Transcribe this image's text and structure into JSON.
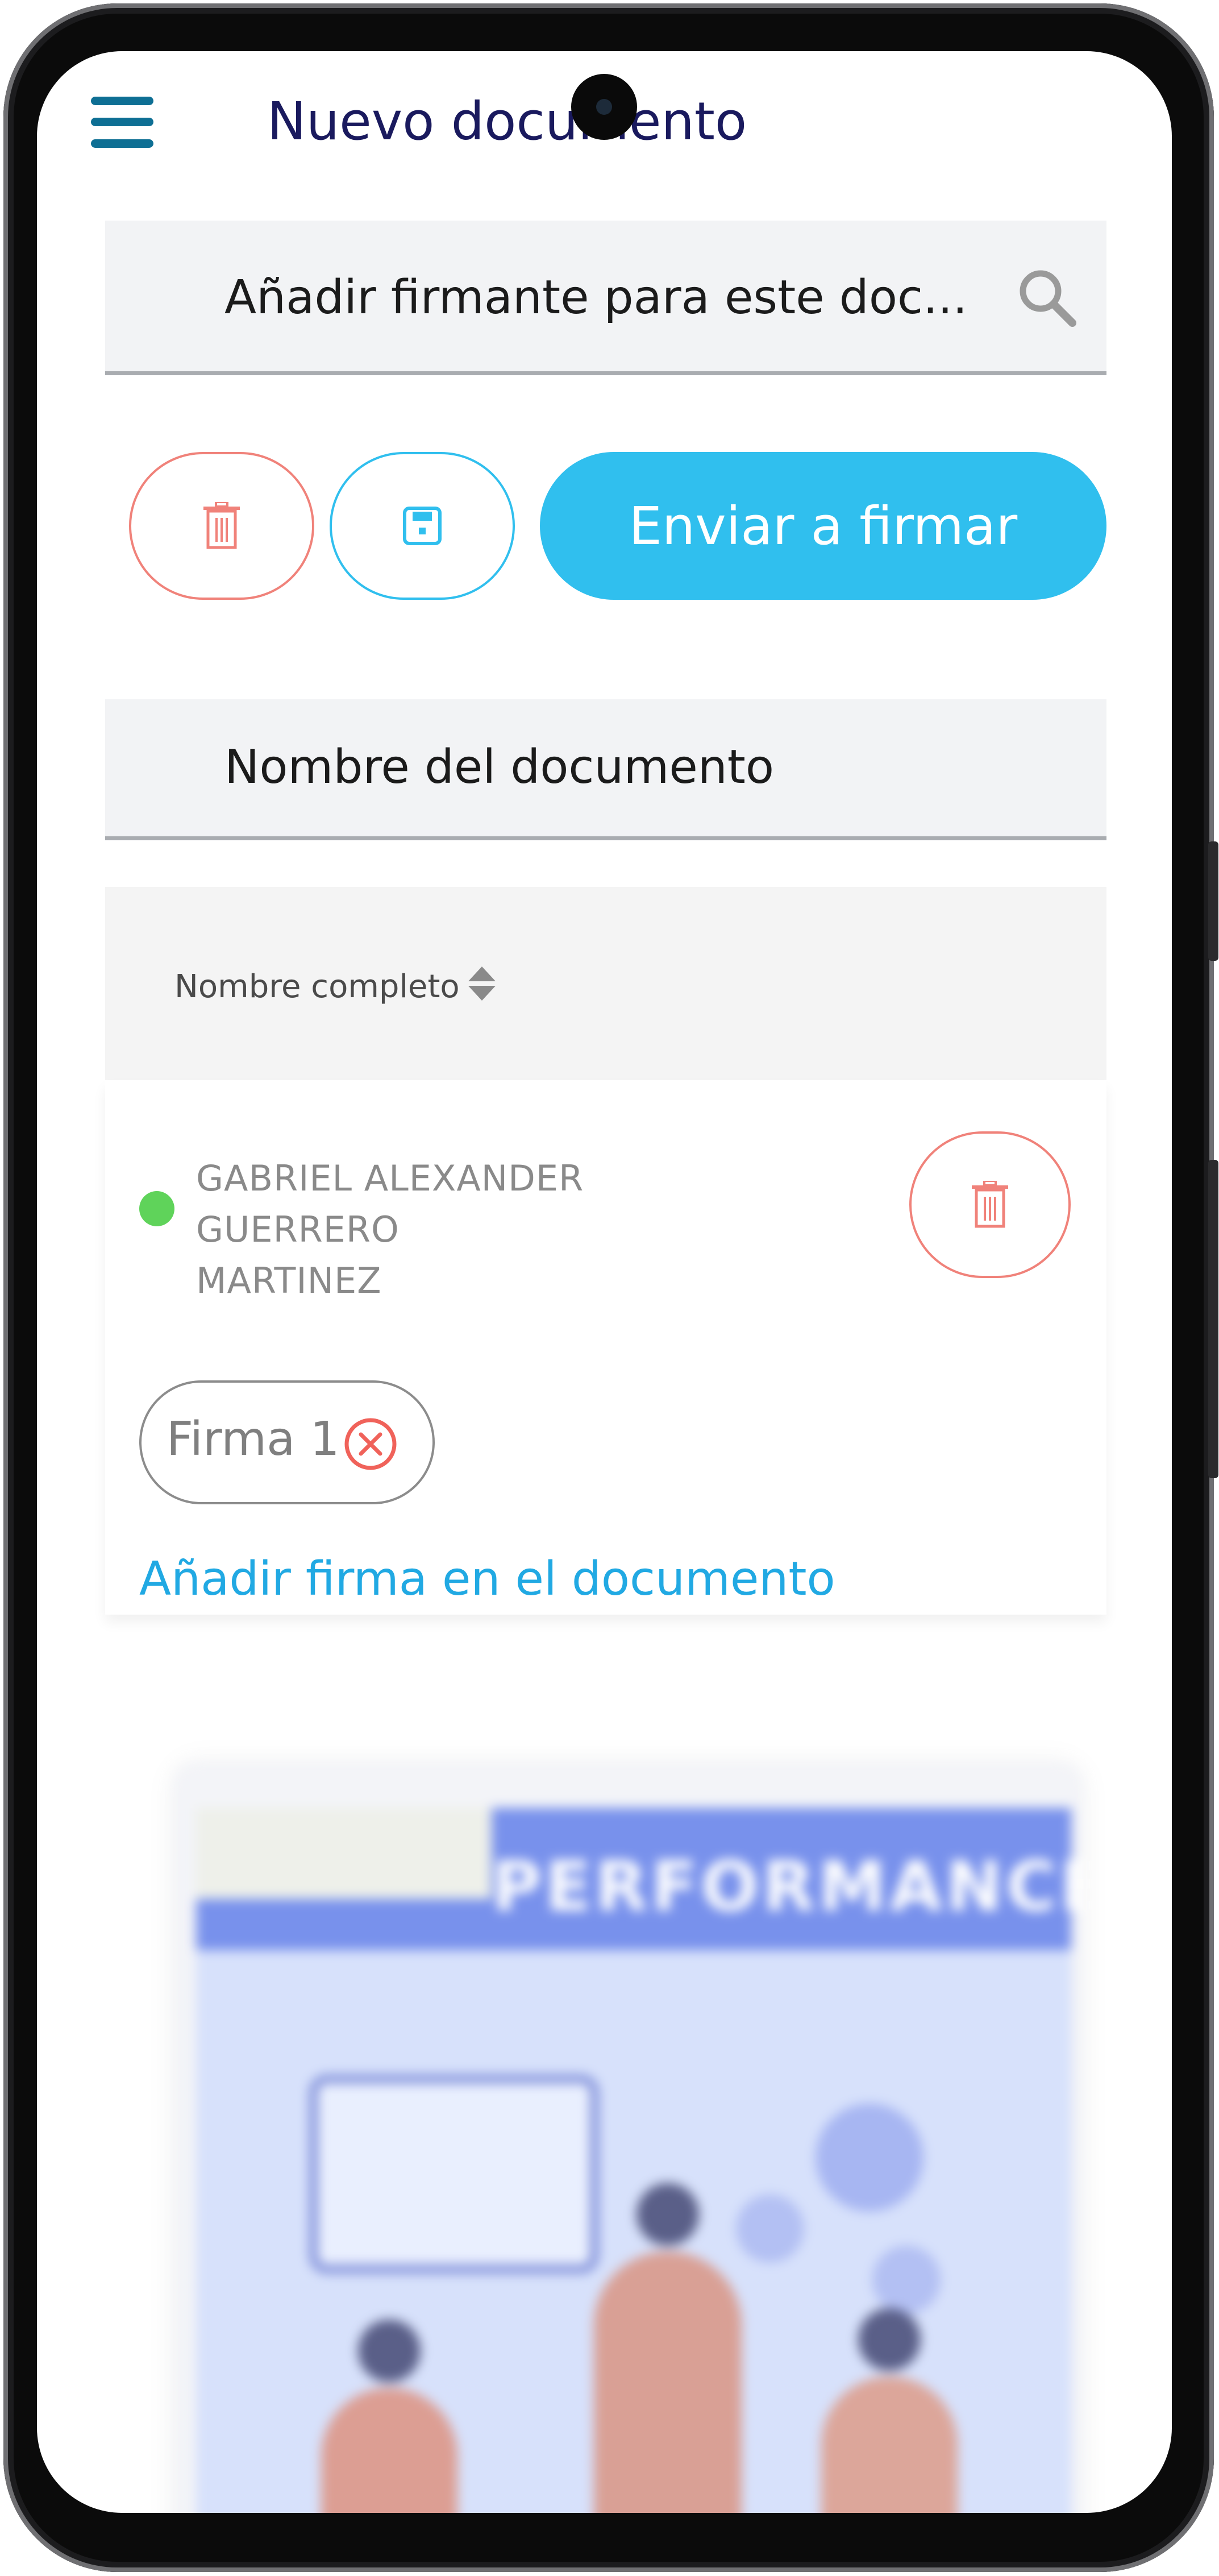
{
  "header": {
    "title": "Nuevo documento"
  },
  "search": {
    "placeholder": "Añadir firmante para este doc..."
  },
  "actions": {
    "send_label": "Enviar a firmar"
  },
  "document": {
    "name_placeholder": "Nombre del documento"
  },
  "table": {
    "column_header": "Nombre completo"
  },
  "signer": {
    "name_line1": "GABRIEL ALEXANDER GUERRERO",
    "name_line2": "MARTINEZ",
    "status_color": "#5fd35a",
    "signature_chip": "Firma 1",
    "add_signature_link": "Añadir firma en el documento"
  },
  "preview": {
    "banner_text": "PERFORMANCE TIPS"
  },
  "colors": {
    "accent": "#30bfee",
    "danger": "#f0827a",
    "title": "#1a1a5e",
    "link": "#21a9e3"
  }
}
